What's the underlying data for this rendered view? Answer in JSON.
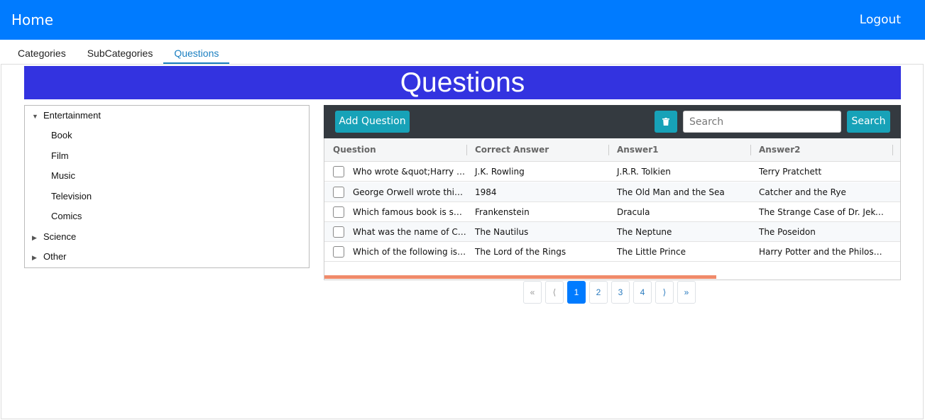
{
  "navbar": {
    "brand": "Home",
    "logout": "Logout",
    "color": "#007bff"
  },
  "tabs": [
    {
      "label": "Categories",
      "active": false
    },
    {
      "label": "SubCategories",
      "active": false
    },
    {
      "label": "Questions",
      "active": true
    }
  ],
  "page_title": "Questions",
  "tree": {
    "nodes": [
      {
        "label": "Entertainment",
        "expanded": true,
        "children": [
          "Book",
          "Film",
          "Music",
          "Television",
          "Comics"
        ]
      },
      {
        "label": "Science",
        "expanded": false
      },
      {
        "label": "Other",
        "expanded": false
      }
    ]
  },
  "toolbar": {
    "add_label": "Add Question",
    "delete_icon": "trash-icon",
    "search_placeholder": "Search",
    "search_value": "",
    "search_label": "Search",
    "accent": "#17a2b8"
  },
  "grid": {
    "columns": [
      "Question",
      "Correct Answer",
      "Answer1",
      "Answer2"
    ],
    "rows": [
      {
        "question": "Who wrote &quot;Harry Potter&quot;?",
        "correct": "J.K. Rowling",
        "answer1": "J.R.R. Tolkien",
        "answer2": "Terry Pratchett"
      },
      {
        "question": "George Orwell wrote this book",
        "correct": "1984",
        "answer1": "The Old Man and the Sea",
        "answer2": "Catcher and the Rye"
      },
      {
        "question": "Which famous book is sub-titled",
        "correct": "Frankenstein",
        "answer1": "Dracula",
        "answer2": "The Strange Case of Dr. Jekyll and Mr. Hyde"
      },
      {
        "question": "What was the name of Captain Nemo",
        "correct": "The Nautilus",
        "answer1": "The Neptune",
        "answer2": "The Poseidon"
      },
      {
        "question": "Which of the following is the",
        "correct": "The Lord of the Rings",
        "answer1": "The Little Prince",
        "answer2": "Harry Potter and the Philosopher's Stone"
      }
    ]
  },
  "pagination": {
    "first": "«",
    "prev": "⟨",
    "next": "⟩",
    "last": "»",
    "pages": [
      "1",
      "2",
      "3",
      "4"
    ],
    "current": "1"
  }
}
